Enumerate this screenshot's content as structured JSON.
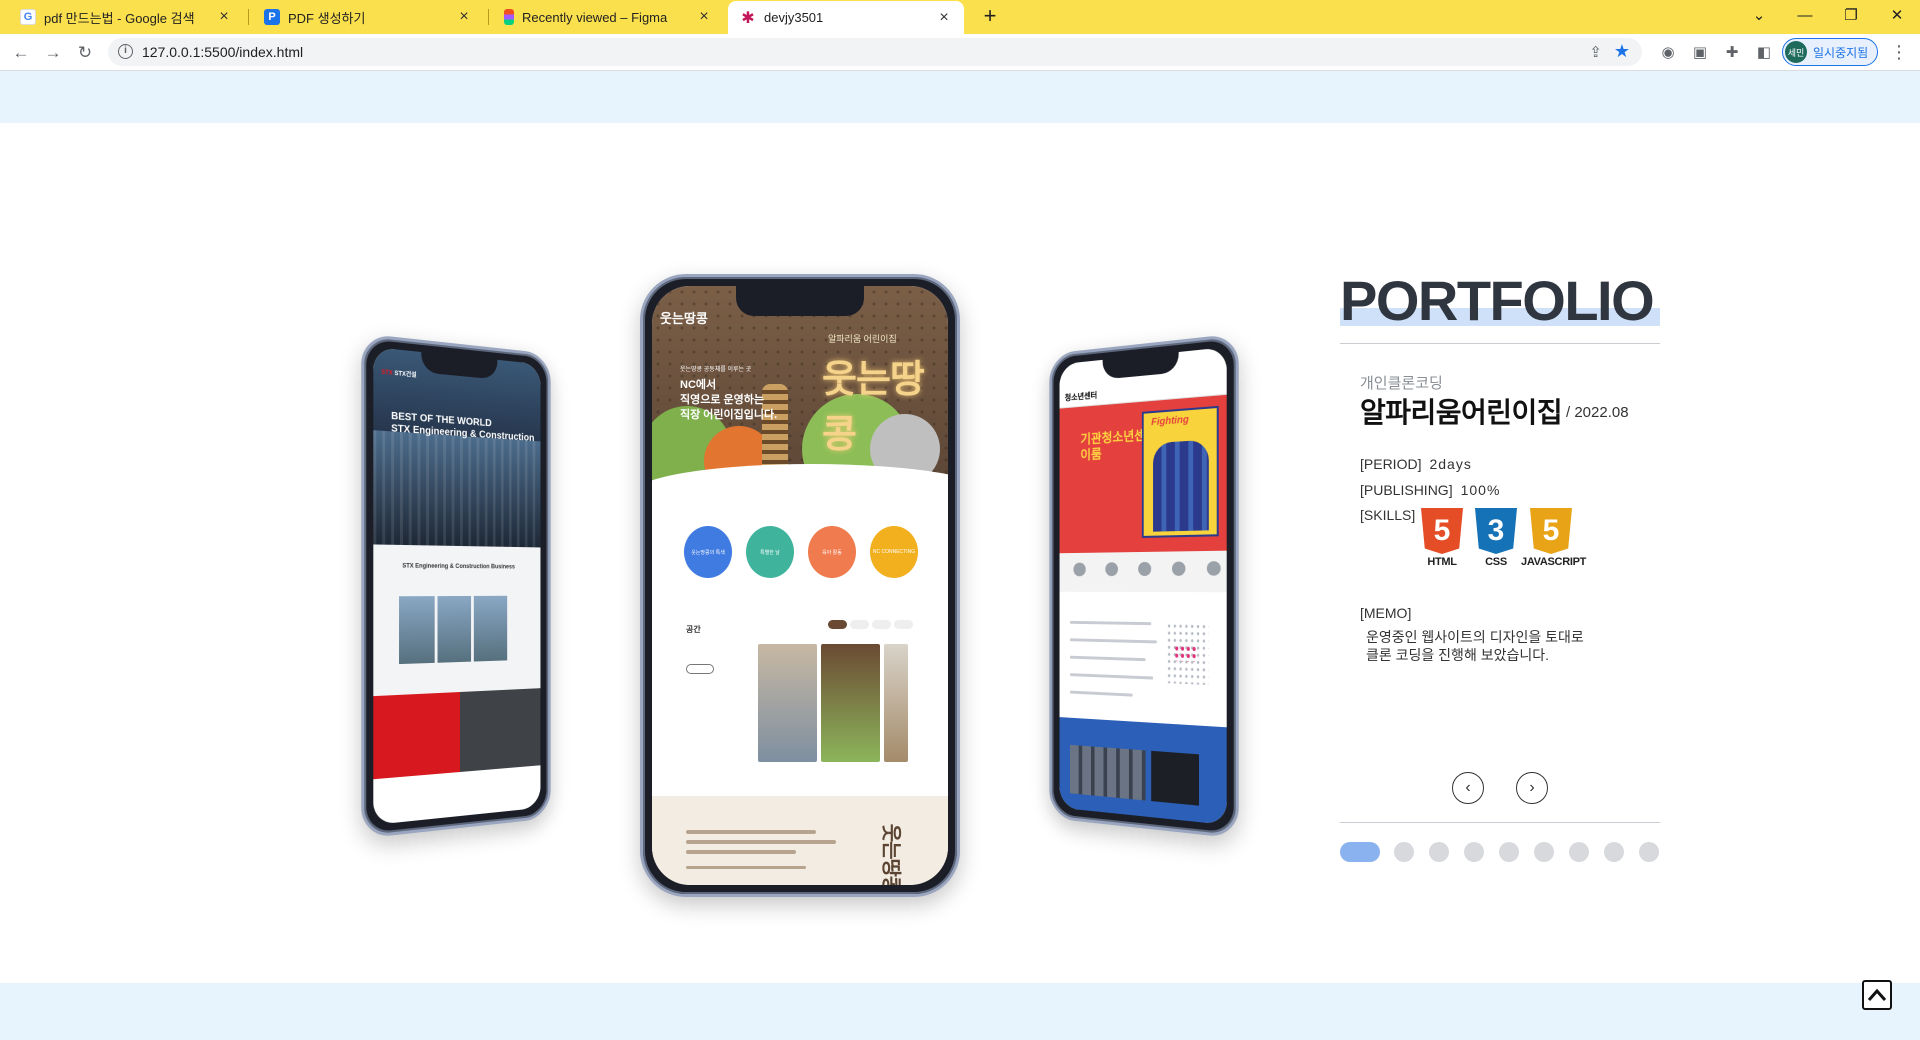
{
  "browser": {
    "tabs": [
      {
        "title": "pdf 만드는법 - Google 검색",
        "favicon": "google-icon"
      },
      {
        "title": "PDF 생성하기",
        "favicon": "doc-icon"
      },
      {
        "title": "Recently viewed – Figma",
        "favicon": "figma-icon"
      },
      {
        "title": "devjy3501",
        "favicon": "asterisk-icon",
        "active": true
      }
    ],
    "close_glyph": "×",
    "new_tab_glyph": "+",
    "url": "127.0.0.1:5500/index.html",
    "profile_avatar": "세민",
    "profile_label": "일시중지됨",
    "accent": "#fbe04d"
  },
  "screens": {
    "left": {
      "logo_brand": "STX",
      "logo_text": "STX건설",
      "headline_1": "BEST OF THE WORLD",
      "headline_2": "STX Engineering & Construction",
      "sub": "STX Engineering & Construction Business"
    },
    "center": {
      "logo": "웃는땅콩",
      "sub": "알파리움 어린이집",
      "big": "웃는땅콩",
      "copy_small": "웃는땅콩 공동체를 이루는 곳",
      "copy_1": "NC에서",
      "copy_2": "직영으로 운영하는",
      "copy_3": "직장 어린이집입니다.",
      "circles": [
        "웃는땅콩의 특색",
        "특별한 날",
        "육아 활동",
        "NC CONNECTING"
      ],
      "space_title": "공간",
      "foot_logo": "웃는땅콩"
    },
    "right": {
      "logo": "청소년센터",
      "hero_1": "기관청소년센터",
      "hero_2": "이룸",
      "poster": "Fighting"
    }
  },
  "portfolio": {
    "title": "PORTFOLIO",
    "category": "개인클론코딩",
    "name": "알파리움어린이집",
    "date": "/ 2022.08",
    "period_label": "[PERIOD]",
    "period_value": "2days",
    "publishing_label": "[PUBLISHING]",
    "publishing_value": "100%",
    "skills_label": "[SKILLS]",
    "skills": [
      {
        "glyph": "5",
        "label": "HTML",
        "color": "#e44d26"
      },
      {
        "glyph": "3",
        "label": "CSS",
        "color": "#1572b6"
      },
      {
        "glyph": "5",
        "label": "JAVASCRIPT",
        "color": "#e8a317"
      }
    ],
    "memo_label": "[MEMO]",
    "memo_line_1": "운영중인 웹사이트의 디자인을 토대로",
    "memo_line_2": "클론 코딩을 진행해 보았습니다.",
    "prev_glyph": "‹",
    "next_glyph": "›",
    "slide_count": 9,
    "active_slide": 1
  },
  "colors": {
    "page_band": "#e8f4fd",
    "title_highlight": "#cfe1f8",
    "active_dot": "#8ab2ee"
  }
}
